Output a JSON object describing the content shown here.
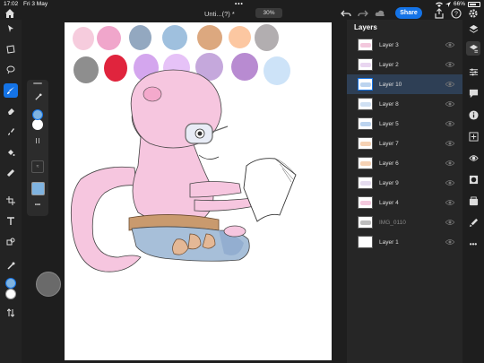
{
  "status": {
    "time": "17:02",
    "date": "Fri 3 May",
    "battery": "66%"
  },
  "topbar": {
    "doc_title": "Unti...(?) *",
    "zoom": "30%",
    "share_label": "Share"
  },
  "swatches": {
    "row1": [
      "#f6ccdd",
      "#f0a6cb",
      "#93a8c0",
      "#9fc0de",
      "#dca87f",
      "#fcc7a1",
      "#b2aeb0"
    ],
    "row2": [
      "#8e8e8e",
      "#e0243d",
      "#d4a6ee",
      "#e6c2f7",
      "#c5a8dc",
      "#b88bd1",
      "#cde3f8"
    ]
  },
  "colors": {
    "accent": "#1473e6",
    "primary_color": "#7fb3e0",
    "secondary_color": "#ffffff"
  },
  "layers": {
    "title": "Layers",
    "items": [
      {
        "name": "Layer 3",
        "selected": false,
        "dim": false
      },
      {
        "name": "Layer 2",
        "selected": false,
        "dim": false
      },
      {
        "name": "Layer 10",
        "selected": true,
        "dim": false
      },
      {
        "name": "Layer 8",
        "selected": false,
        "dim": false
      },
      {
        "name": "Layer 5",
        "selected": false,
        "dim": false
      },
      {
        "name": "Layer 7",
        "selected": false,
        "dim": false
      },
      {
        "name": "Layer 6",
        "selected": false,
        "dim": false
      },
      {
        "name": "Layer 9",
        "selected": false,
        "dim": false
      },
      {
        "name": "Layer 4",
        "selected": false,
        "dim": false
      },
      {
        "name": "IMG_0110",
        "selected": false,
        "dim": true
      },
      {
        "name": "Layer 1",
        "selected": false,
        "dim": false
      }
    ]
  },
  "left_tools": [
    "select-icon",
    "transform-icon",
    "lasso-icon",
    "brush-icon",
    "eraser-icon",
    "smudge-icon",
    "fill-icon",
    "healing-icon",
    "crop-icon",
    "type-icon",
    "shape-icon",
    "eyedropper-icon"
  ],
  "right_panel_icons": [
    "layers-icon",
    "layer-properties-icon",
    "adjustments-icon",
    "comment-icon",
    "info-icon",
    "add-layer-icon",
    "visibility-icon",
    "mask-icon",
    "clipping-icon",
    "trash-icon",
    "more-icon"
  ]
}
